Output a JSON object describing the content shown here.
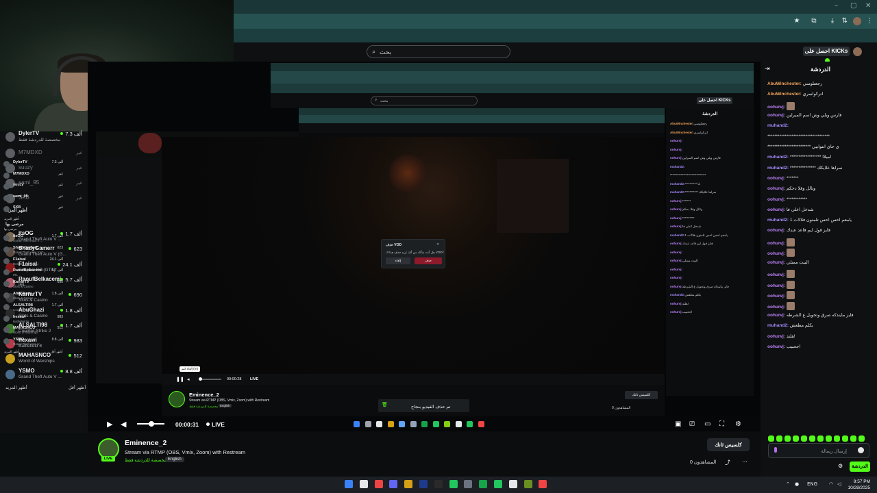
{
  "browser": {
    "window_controls": [
      "–",
      "▢",
      "✕"
    ]
  },
  "header": {
    "search_placeholder": "بحث",
    "kicks_label": "احصل على KICKs"
  },
  "sidebar": {
    "top_items": [
      {
        "name": "DylerTV",
        "category": "مخصصة للدردشة فقط",
        "count": "7.3 ألف",
        "live": true
      },
      {
        "name": "M7MDXD",
        "category": "",
        "count": "غير",
        "live": false
      },
      {
        "name": "suuzy",
        "category": "",
        "count": "غير",
        "live": false
      },
      {
        "name": "sami_95",
        "category": "",
        "count": "غير",
        "live": false
      },
      {
        "name": "SXB",
        "category": "",
        "count": "غير",
        "live": false
      }
    ],
    "show_more_1": "أظهر المزيد",
    "recommended_title": "مرصى بها",
    "recommended": [
      {
        "name": "itsOG",
        "category": "Grand Theft Auto V ...",
        "count": "1.7 ألف"
      },
      {
        "name": "ShadyGamerr",
        "category": "Grand Theft Auto V (G...",
        "count": "623"
      },
      {
        "name": "F1aisal",
        "category": "Respect RP (GTA)",
        "count": "24.1 ألف"
      },
      {
        "name": "RaoufBelkacemi",
        "category": "IRL",
        "count": "5.7 ألف"
      },
      {
        "name": "KarrarTV",
        "category": "Slots & Casino",
        "count": "690"
      },
      {
        "name": "AbuGhazi",
        "category": "Slots & Casino",
        "count": "1.8 ألف"
      },
      {
        "name": "ALSALTI98",
        "category": "Counter-Strike 2",
        "count": "1.7 ألف"
      },
      {
        "name": "hexawi",
        "category": "Battlefield 6",
        "count": "983"
      },
      {
        "name": "MAHASNCO",
        "category": "World of Warships",
        "count": "512"
      },
      {
        "name": "YSMO",
        "category": "Grand Theft Auto V ...",
        "count": "8.8 ألف"
      }
    ],
    "show_more_2": "أظهر المزيد",
    "show_less": "أظهر أقل"
  },
  "nested": {
    "search_placeholder": "بحث",
    "kicks_label": "احصل على KICKs",
    "chat_title": "الدردشة",
    "chat_lines": [
      {
        "user": "AbuWinchester:",
        "text": "رجعتلوسي",
        "color": "#f4a35a"
      },
      {
        "user": "AbuWinchester:",
        "text": "اتركواسري",
        "color": "#f4a35a"
      },
      {
        "user": "oohurvj:",
        "text": "",
        "color": "#c084fc"
      },
      {
        "user": "oohurvj:",
        "text": "",
        "color": "#c084fc"
      },
      {
        "user": "oohurvj:",
        "text": "فارس ويلي وش اسم الميرلين",
        "color": "#c084fc"
      },
      {
        "user": "muhand2:",
        "text": "",
        "color": "#a78bfa"
      },
      {
        "user": "",
        "text": "******************************",
        "color": "#e6e6e6"
      },
      {
        "user": "muhand2:",
        "text": "********** ابا",
        "color": "#a78bfa"
      },
      {
        "user": "muhand2:",
        "text": "*********** سراها علايكك",
        "color": "#a78bfa"
      },
      {
        "user": "oohurvj:",
        "text": "*******",
        "color": "#c084fc"
      },
      {
        "user": "oohurvj:",
        "text": "وتالل وقلا دحكم",
        "color": "#c084fc"
      },
      {
        "user": "oohurvj:",
        "text": "**********",
        "color": "#c084fc"
      },
      {
        "user": "oohurvj:",
        "text": "شدخل اعلى فا",
        "color": "#c084fc"
      },
      {
        "user": "muhand2:",
        "text": "1 يامعم احس احس تلمنون فلالات",
        "color": "#a78bfa"
      },
      {
        "user": "oohurvj:",
        "text": "فايز قول ليم قاعد عندك",
        "color": "#c084fc"
      },
      {
        "user": "oohurvj:",
        "text": "",
        "color": "#c084fc"
      },
      {
        "user": "oohurvj:",
        "text": "البيت ممتلي",
        "color": "#c084fc"
      },
      {
        "user": "oohurvj:",
        "text": "",
        "color": "#c084fc"
      },
      {
        "user": "oohurvj:",
        "text": "",
        "color": "#c084fc"
      },
      {
        "user": "oohurvj:",
        "text": "فايز مايندكه صرق وتحويل ع الشرطه",
        "color": "#c084fc"
      },
      {
        "user": "muhand2:",
        "text": "بكلم مطعش",
        "color": "#a78bfa"
      },
      {
        "user": "oohurvj:",
        "text": "هلتد!",
        "color": "#c084fc"
      },
      {
        "user": "oohurvj:",
        "text": "اجحبيب",
        "color": "#c084fc"
      }
    ],
    "vod_dialog": {
      "title": "حذف VOD",
      "text": "هل أنت متأكد من أنك تريد حذف هذا الـ VOD؟",
      "cancel": "إلغاء",
      "confirm": "حذف"
    },
    "tooltip": "إلغاء كتم (m)",
    "time": "00:00:28",
    "live": "LIVE",
    "streamer": "Eminence_2",
    "title": "Stream via RTMP (OBS, Vmix, Zoom) with Restream",
    "category": "مخصصة للدردشة فقط",
    "tag": "English",
    "clip": "كلسيس ثانك",
    "viewers": "0 المشاهدون",
    "toast": "تم حذف الفيديو بنجاح"
  },
  "player": {
    "time": "00:00:31",
    "live": "LIVE"
  },
  "stream": {
    "streamer": "Eminence_2",
    "live_badge": "LIVE",
    "title": "Stream via RTMP (OBS, Vmix, Zoom) with Restream",
    "category": "مخصصة للدردشة فقط",
    "tag": "English",
    "clip_label": "كلسيس ثانك",
    "viewers": "0 المشاهدون"
  },
  "chat": {
    "title": "الدردشة",
    "messages": [
      {
        "user": "AbuWinchester:",
        "text": "رجعتلوسي",
        "color": "#f4a35a",
        "emote": false
      },
      {
        "user": "AbuWinchester:",
        "text": "اتركواسري",
        "color": "#f4a35a",
        "emote": false
      },
      {
        "user": "oohurvj:",
        "text": "",
        "color": "#c084fc",
        "emote": true
      },
      {
        "user": "oohurvj:",
        "text": "فارس ويلي وش اسم الميرلين",
        "color": "#c084fc",
        "emote": false
      },
      {
        "user": "muhand2:",
        "text": "",
        "color": "#a78bfa",
        "emote": false
      },
      {
        "user": "",
        "text": "************************************",
        "color": "#e6e8ea",
        "emote": false
      },
      {
        "user": "",
        "text": "************************* ي حاي انتوابيي",
        "color": "#e6e8ea",
        "emote": false
      },
      {
        "user": "muhand2:",
        "text": "****************** اميلاا",
        "color": "#a78bfa",
        "emote": false
      },
      {
        "user": "muhand2:",
        "text": "*************** سراها علايكك",
        "color": "#a78bfa",
        "emote": false
      },
      {
        "user": "oohurvj:",
        "text": "*******",
        "color": "#c084fc",
        "emote": false
      },
      {
        "user": "oohurvj:",
        "text": "وتالل وقلا دحكم",
        "color": "#c084fc",
        "emote": false
      },
      {
        "user": "oohurvj:",
        "text": "************",
        "color": "#c084fc",
        "emote": false
      },
      {
        "user": "oohurvj:",
        "text": "شدخل اعلى فا",
        "color": "#c084fc",
        "emote": false
      },
      {
        "user": "muhand2:",
        "text": "1 يامعم احس احس تلمنون فلالات",
        "color": "#a78bfa",
        "emote": false
      },
      {
        "user": "oohurvj:",
        "text": "فايز قول ليم قاعد عندك",
        "color": "#c084fc",
        "emote": false
      },
      {
        "user": "oohurvj:",
        "text": "",
        "color": "#c084fc",
        "emote": true
      },
      {
        "user": "oohurvj:",
        "text": "",
        "color": "#c084fc",
        "emote": true
      },
      {
        "user": "oohurvj:",
        "text": "البيت ممتلي",
        "color": "#c084fc",
        "emote": false
      },
      {
        "user": "oohurvj:",
        "text": "",
        "color": "#c084fc",
        "emote": true
      },
      {
        "user": "oohurvj:",
        "text": "",
        "color": "#c084fc",
        "emote": true
      },
      {
        "user": "oohurvj:",
        "text": "",
        "color": "#c084fc",
        "emote": true
      },
      {
        "user": "oohurvj:",
        "text": "",
        "color": "#c084fc",
        "emote": true
      },
      {
        "user": "oohurvj:",
        "text": "فايز مايندكه صرق وتحويل ع الشرطه",
        "color": "#c084fc",
        "emote": false
      },
      {
        "user": "muhand2:",
        "text": "بكلم مطعش",
        "color": "#a78bfa",
        "emote": false
      },
      {
        "user": "oohurvj:",
        "text": "هلتد!",
        "color": "#c084fc",
        "emote": false
      },
      {
        "user": "oohurvj:",
        "text": "اجحبيب",
        "color": "#c084fc",
        "emote": false
      }
    ],
    "input_placeholder": "إرسال رسالة",
    "send_label": "الدردشة"
  },
  "taskbar": {
    "lang": "ENG",
    "time": "8:57 PM",
    "date": "10/28/2025"
  },
  "colors": {
    "brand_green": "#53fc18",
    "chat_orange": "#f4a35a",
    "chat_purple": "#c084fc"
  }
}
